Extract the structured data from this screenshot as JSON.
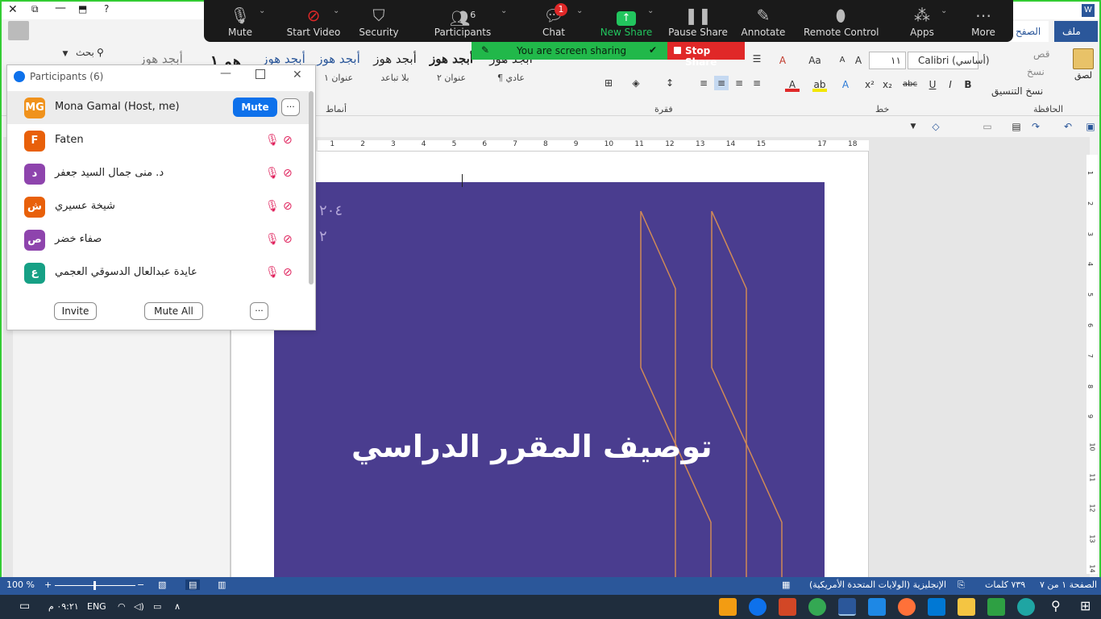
{
  "word": {
    "tabs": [
      "ملف",
      "الصفح"
    ],
    "search_label": "بحث",
    "styles": [
      {
        "big": "أبجد هوز",
        "small": "¶ عادي"
      },
      {
        "big": "أبجد هوز",
        "small": "عنوان ٢"
      },
      {
        "big": "أبجد هوز",
        "small": "بلا تباعد"
      },
      {
        "big": "أبجد هوز",
        "small": "عنوان ١"
      },
      {
        "big": "أبجد هوز",
        "small": ""
      },
      {
        "big": "هو ١",
        "small": ""
      },
      {
        "big": "أبجد هوز",
        "small": ""
      }
    ],
    "group_labels": {
      "styles": "أنماط",
      "paragraph": "فقرة",
      "font": "خط",
      "clipboard": "الحافظة"
    },
    "clipboard": {
      "paste": "لصق",
      "cut": "قص",
      "copy": "نسخ",
      "format_painter": "نسخ التنسيق"
    },
    "font_name": "Calibri (أساسي)",
    "font_size": "١١",
    "format_buttons": [
      "B",
      "I",
      "U",
      "abc",
      "x₂",
      "x²"
    ],
    "ruler_numbers": [
      "18",
      "17",
      "15",
      "14",
      "13",
      "12",
      "11",
      "10",
      "9",
      "8",
      "7",
      "6",
      "5",
      "4",
      "3",
      "2",
      "1"
    ],
    "vruler_numbers": [
      "1",
      "2",
      "3",
      "4",
      "5",
      "6",
      "7",
      "8",
      "9",
      "10",
      "11",
      "12",
      "13",
      "14"
    ],
    "cover_title": "توصيف المقرر الدراسي",
    "cover_digits": [
      "٢٠٤",
      "٢"
    ],
    "status": {
      "page": "الصفحة ١ من ٧",
      "words": "٧٣٩ كلمات",
      "language": "الإنجليزية (الولايات المتحدة الأمريكية)",
      "zoom": "100 %"
    }
  },
  "zoom_bar": {
    "buttons": [
      {
        "label": "Mute",
        "icon": "mic-icon"
      },
      {
        "label": "Start Video",
        "icon": "video-off-icon"
      },
      {
        "label": "Security",
        "icon": "shield-icon"
      },
      {
        "label": "Participants",
        "icon": "participants-icon",
        "count": "6"
      },
      {
        "label": "Chat",
        "icon": "chat-icon",
        "badge": "1"
      },
      {
        "label": "New Share",
        "icon": "share-icon"
      },
      {
        "label": "Pause Share",
        "icon": "pause-icon"
      },
      {
        "label": "Annotate",
        "icon": "pencil-icon"
      },
      {
        "label": "Remote Control",
        "icon": "mouse-icon"
      },
      {
        "label": "Apps",
        "icon": "apps-icon"
      },
      {
        "label": "More",
        "icon": "more-icon"
      }
    ],
    "sharing_text": "You are screen sharing",
    "stop_share": "Stop Share"
  },
  "participants": {
    "title": "Participants (6)",
    "list": [
      {
        "initials": "MG",
        "name": "Mona Gamal (Host, me)",
        "color": "#f0921c",
        "host": true
      },
      {
        "initials": "F",
        "name": "Faten",
        "color": "#e8600a"
      },
      {
        "initials": "د",
        "name": "د. منى جمال السيد جعفر",
        "color": "#8e44ad"
      },
      {
        "initials": "ش",
        "name": "شيخة عسيري",
        "color": "#e8600a"
      },
      {
        "initials": "ص",
        "name": "صفاء خضر",
        "color": "#8e44ad"
      },
      {
        "initials": "ع",
        "name": "عايدة عبدالعال الدسوقي العجمي",
        "color": "#16a085"
      }
    ],
    "mute_label": "Mute",
    "more_label": "···",
    "invite_label": "Invite",
    "mute_all_label": "Mute All"
  },
  "taskbar": {
    "time": "٠٩:٢١ م",
    "language": "ENG"
  },
  "colors": {
    "word_blue": "#2b579a",
    "zoom_blue": "#0e71eb",
    "share_green": "#21b84a",
    "stop_red": "#e02828",
    "cover_purple": "#4a3d8f",
    "line_orange": "#d08a56"
  }
}
